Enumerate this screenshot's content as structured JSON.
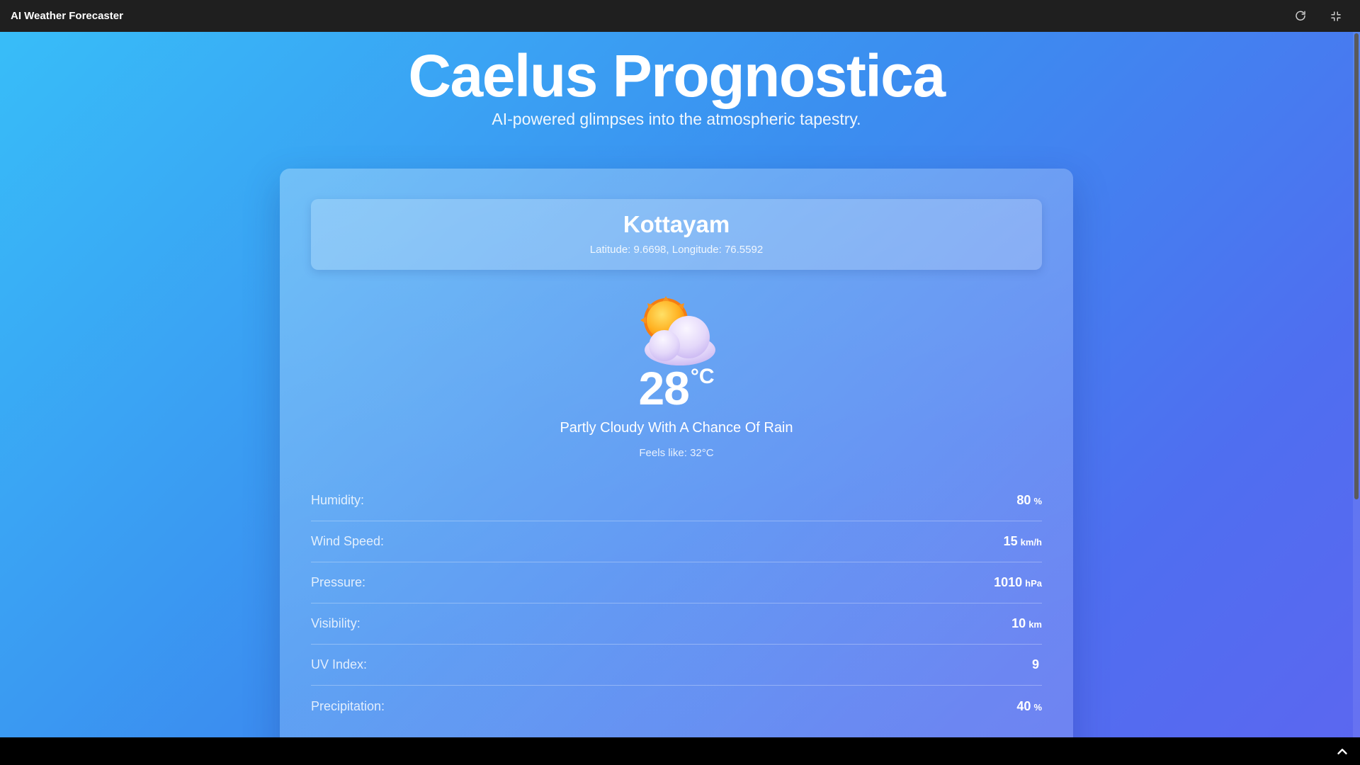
{
  "app": {
    "title": "AI Weather Forecaster"
  },
  "toolbar": {
    "refresh_icon": "refresh-icon",
    "minimize_icon": "minimize-icon"
  },
  "hero": {
    "title": "Caelus Prognostica",
    "subtitle": "AI-powered glimpses into the atmospheric tapestry."
  },
  "location": {
    "name": "Kottayam",
    "coords": "Latitude: 9.6698, Longitude: 76.5592"
  },
  "current": {
    "icon": "partly-cloudy-icon",
    "temperature": "28",
    "unit": "°C",
    "condition": "Partly Cloudy With A Chance Of Rain",
    "feels_like": "Feels like: 32°C"
  },
  "metrics": [
    {
      "label": "Humidity:",
      "value": "80",
      "unit": "%"
    },
    {
      "label": "Wind Speed:",
      "value": "15",
      "unit": "km/h"
    },
    {
      "label": "Pressure:",
      "value": "1010",
      "unit": "hPa"
    },
    {
      "label": "Visibility:",
      "value": "10",
      "unit": "km"
    },
    {
      "label": "UV Index:",
      "value": "9",
      "unit": ""
    },
    {
      "label": "Precipitation:",
      "value": "40",
      "unit": "%"
    }
  ],
  "colors": {
    "gradient_start": "#38bdf8",
    "gradient_end": "#5b67f0",
    "topbar": "#1f1f1f"
  }
}
